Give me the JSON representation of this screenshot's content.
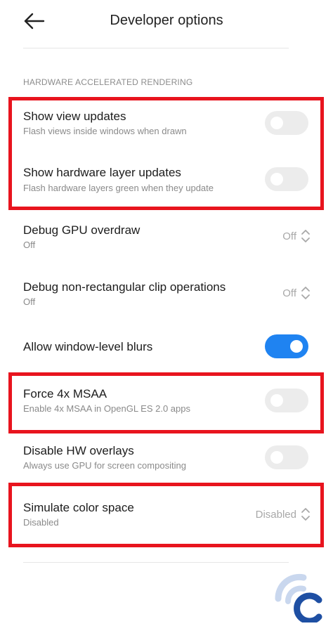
{
  "header": {
    "title": "Developer options",
    "back_icon": "arrow-left-icon"
  },
  "section": {
    "label": "HARDWARE ACCELERATED RENDERING"
  },
  "rows": [
    {
      "title": "Show view updates",
      "subtitle": "Flash views inside windows when drawn",
      "control": "toggle",
      "on": false
    },
    {
      "title": "Show hardware layer updates",
      "subtitle": "Flash hardware layers green when they update",
      "control": "toggle",
      "on": false
    },
    {
      "title": "Debug GPU overdraw",
      "subtitle": "Off",
      "control": "select",
      "value": "Off"
    },
    {
      "title": "Debug non-rectangular clip operations",
      "subtitle": "Off",
      "control": "select",
      "value": "Off"
    },
    {
      "title": "Allow window-level blurs",
      "control": "toggle",
      "on": true
    },
    {
      "title": "Force 4x MSAA",
      "subtitle": "Enable 4x MSAA in OpenGL ES 2.0 apps",
      "control": "toggle",
      "on": false
    },
    {
      "title": "Disable HW overlays",
      "subtitle": "Always use GPU for screen compositing",
      "control": "toggle",
      "on": false
    },
    {
      "title": "Simulate color space",
      "subtitle": "Disabled",
      "control": "select",
      "value": "Disabled"
    }
  ],
  "colors": {
    "toggle_on": "#1f83f1",
    "toggle_off": "#ececec",
    "highlight": "#e8141e"
  },
  "watermark": {
    "icon": "watermark-logo-icon"
  }
}
